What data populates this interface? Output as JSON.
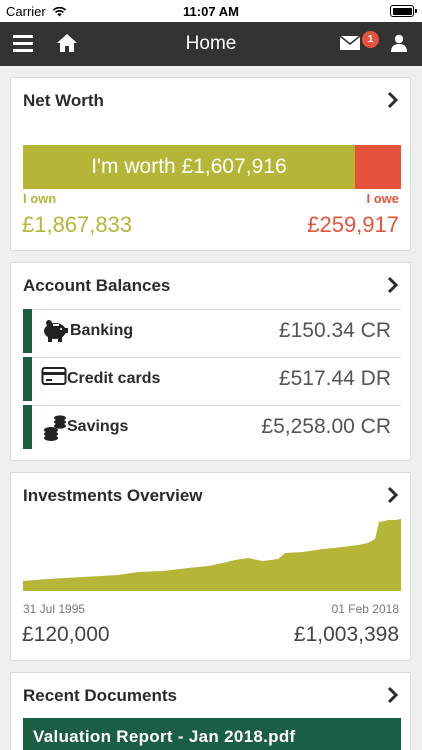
{
  "status_bar": {
    "carrier": "Carrier",
    "time": "11:07 AM"
  },
  "navbar": {
    "title": "Home",
    "messages_count": "1",
    "menu_icon": "hamburger-icon",
    "home_icon": "house-icon",
    "mail_icon": "envelope-icon",
    "profile_icon": "person-icon"
  },
  "net_worth": {
    "title": "Net Worth",
    "worth_text": "I'm worth £1,607,916",
    "own_label": "I own",
    "own_value": "£1,867,833",
    "owe_label": "I owe",
    "owe_value": "£259,917",
    "own_fraction": 0.878
  },
  "account_balances": {
    "title": "Account Balances",
    "rows": [
      {
        "label": "Banking",
        "value": "£150.34 CR",
        "icon": "piggy-bank-icon"
      },
      {
        "label": "Credit cards",
        "value": "£517.44 DR",
        "icon": "credit-card-icon"
      },
      {
        "label": "Savings",
        "value": "£5,258.00 CR",
        "icon": "coins-icon"
      }
    ]
  },
  "investments": {
    "title": "Investments Overview",
    "start_date": "31 Jul 1995",
    "end_date": "01 Feb 2018",
    "start_value": "£120,000",
    "end_value": "£1,003,398"
  },
  "documents": {
    "title": "Recent Documents",
    "items": [
      {
        "name": "Valuation Report - Jan 2018.pdf"
      }
    ]
  },
  "colors": {
    "own": "#b5b637",
    "owe": "#e6533c",
    "accent_green": "#1a5e44",
    "navbar": "#333333"
  }
}
